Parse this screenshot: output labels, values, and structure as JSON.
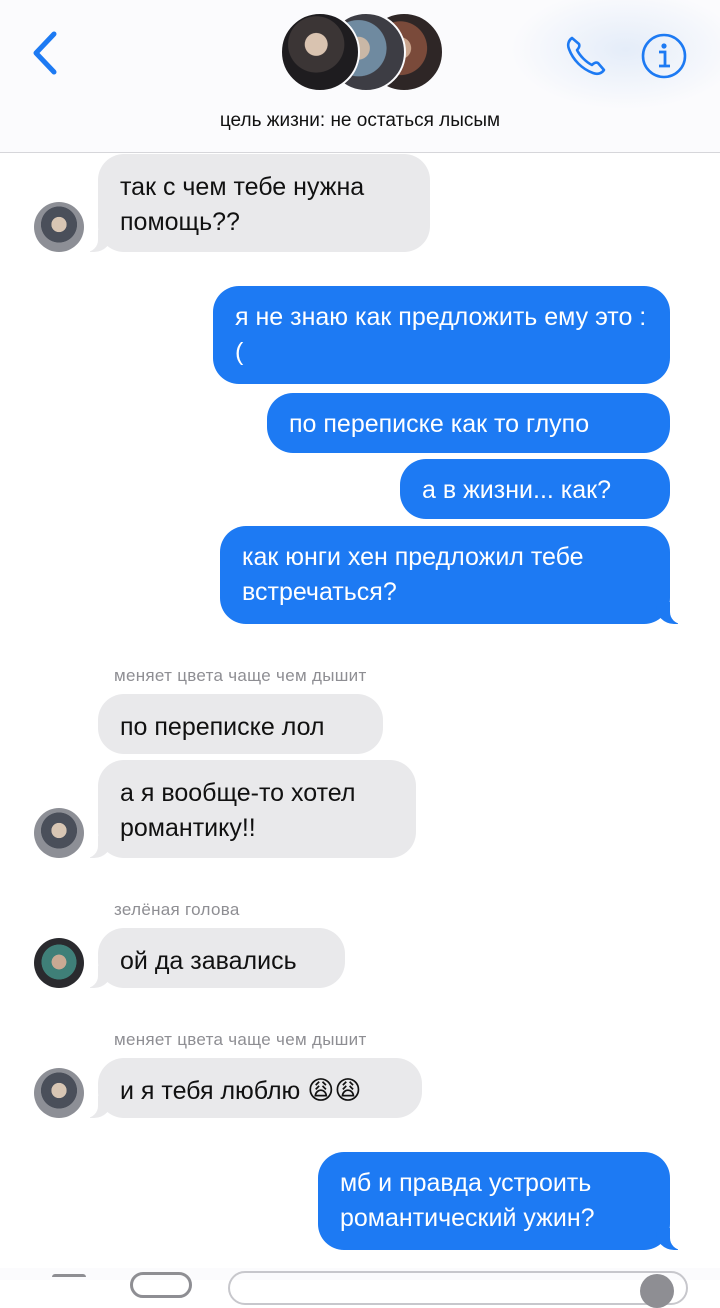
{
  "header": {
    "group_name": "цель жизни: не остаться лысым",
    "back_icon": "chevron-left-icon",
    "call_icon": "phone-icon",
    "info_icon": "info-icon",
    "accent_color": "#1d7af3"
  },
  "messages": [
    {
      "type": "in",
      "text": "так с чем тебе нужна помощь??"
    },
    {
      "type": "out",
      "text": "я не знаю как предложить ему это :("
    },
    {
      "type": "out",
      "text": "по переписке как то глупо"
    },
    {
      "type": "out",
      "text": "а в жизни... как?"
    },
    {
      "type": "out",
      "text": "как юнги хен предложил тебе встречаться?"
    },
    {
      "type": "sender",
      "text": "меняет цвета чаще чем дышит"
    },
    {
      "type": "in",
      "text": "по переписке лол"
    },
    {
      "type": "in",
      "text": "а я вообще-то хотел романтику!!"
    },
    {
      "type": "sender",
      "text": "зелёная голова"
    },
    {
      "type": "in",
      "text": "ой да завались"
    },
    {
      "type": "sender",
      "text": "меняет цвета чаще чем дышит"
    },
    {
      "type": "in",
      "text": "и я тебя люблю",
      "emoji": "😩😩"
    },
    {
      "type": "out",
      "text": "мб и правда устроить романтический ужин?"
    }
  ],
  "colors": {
    "incoming_bubble": "#e9e9eb",
    "outgoing_bubble": "#1d7af3",
    "sender_label": "#8e8e93"
  }
}
